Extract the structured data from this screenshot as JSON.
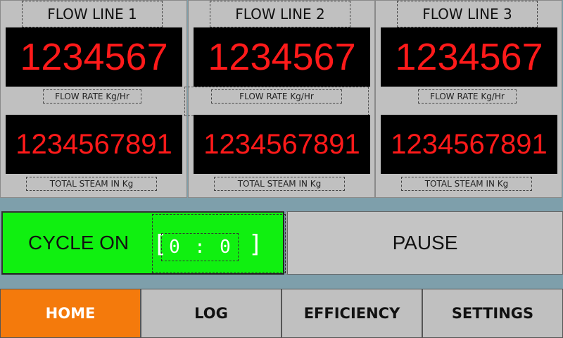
{
  "flow_lines": [
    {
      "title": "FLOW LINE 1",
      "flow_rate": "1234567",
      "flow_rate_label": "FLOW RATE Kg/Hr",
      "total_steam": "1234567891",
      "total_steam_label": "TOTAL STEAM IN Kg"
    },
    {
      "title": "FLOW LINE 2",
      "flow_rate": "1234567",
      "flow_rate_label": "FLOW RATE Kg/Hr",
      "total_steam": "1234567891",
      "total_steam_label": "TOTAL STEAM IN Kg"
    },
    {
      "title": "FLOW LINE 3",
      "flow_rate": "1234567",
      "flow_rate_label": "FLOW RATE Kg/Hr",
      "total_steam": "1234567891",
      "total_steam_label": "TOTAL STEAM IN Kg"
    }
  ],
  "cycle": {
    "label": "CYCLE ON",
    "bracket_left": "[",
    "bracket_right": "]",
    "minutes": "0",
    "separator": ":",
    "seconds": "0",
    "color": "#10f010"
  },
  "pause": {
    "label": "PAUSE"
  },
  "nav": {
    "items": [
      {
        "label": "HOME",
        "active": true
      },
      {
        "label": "LOG",
        "active": false
      },
      {
        "label": "EFFICIENCY",
        "active": false
      },
      {
        "label": "SETTINGS",
        "active": false
      }
    ],
    "active_color": "#f47a0c"
  },
  "colors": {
    "background": "#7e9fab",
    "panel": "#c0c0c0",
    "display_bg": "#000000",
    "display_text": "#ff1a1a"
  }
}
